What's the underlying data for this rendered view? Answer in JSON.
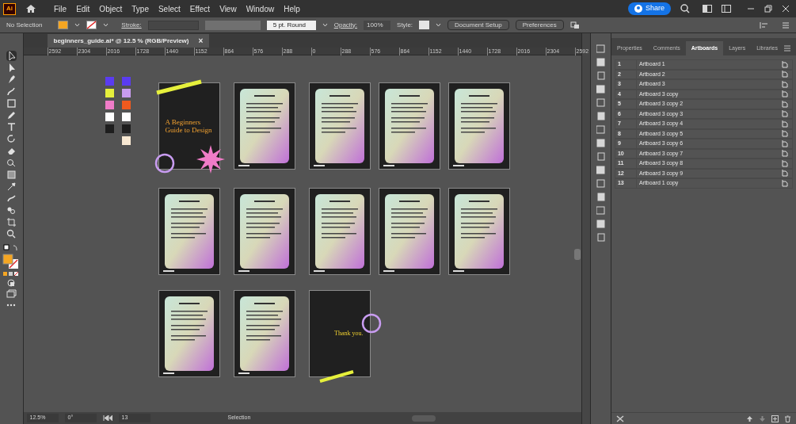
{
  "app": {
    "logo": "Ai",
    "menu": [
      "File",
      "Edit",
      "Object",
      "Type",
      "Select",
      "Effect",
      "View",
      "Window",
      "Help"
    ],
    "share": "Share"
  },
  "control_bar": {
    "selection": "No Selection",
    "stroke_label": "Stroke:",
    "brush": "5 pt. Round",
    "opacity_label": "Opacity:",
    "opacity": "100%",
    "style_label": "Style:",
    "document_setup": "Document Setup",
    "preferences": "Preferences"
  },
  "document_tab": {
    "title": "beginners_guide.ai* @ 12.5 % (RGB/Preview)",
    "close": "×"
  },
  "ruler": [
    "2592",
    "2304",
    "2016",
    "1728",
    "1440",
    "1152",
    "864",
    "576",
    "288",
    "0",
    "288",
    "576",
    "864",
    "1152",
    "1440",
    "1728",
    "2016",
    "2304",
    "2592"
  ],
  "swatches": [
    {
      "color": "#5a3cf0"
    },
    {
      "color": "#5a3cf0"
    },
    {
      "color": "#e6f03c"
    },
    {
      "color": "#c89cf0"
    },
    {
      "color": "#f07cc8"
    },
    {
      "color": "#f05a1e"
    },
    {
      "color": "#ffffff"
    },
    {
      "color": "#ffffff"
    },
    {
      "color": "#1e1e1e"
    },
    {
      "color": "#1e1e1e"
    },
    {
      "color": "#f8e8d2"
    }
  ],
  "artboards": [
    {
      "kind": "cover",
      "title": "A Beginners Guide to Design"
    },
    {
      "kind": "page"
    },
    {
      "kind": "page"
    },
    {
      "kind": "page"
    },
    {
      "kind": "page"
    },
    {
      "kind": "page"
    },
    {
      "kind": "page"
    },
    {
      "kind": "page"
    },
    {
      "kind": "page"
    },
    {
      "kind": "page"
    },
    {
      "kind": "page"
    },
    {
      "kind": "page"
    },
    {
      "kind": "thanks",
      "title": "Thank you."
    }
  ],
  "panel": {
    "tabs": [
      {
        "label": "Properties",
        "selected": false
      },
      {
        "label": "Comments",
        "selected": false
      },
      {
        "label": "Artboards",
        "selected": true
      },
      {
        "label": "Layers",
        "selected": false
      },
      {
        "label": "Libraries",
        "selected": false
      }
    ],
    "rows": [
      {
        "number": "1",
        "name": "Artboard 1"
      },
      {
        "number": "2",
        "name": "Artboard 2"
      },
      {
        "number": "3",
        "name": "Artboard 3"
      },
      {
        "number": "4",
        "name": "Artboard 3 copy"
      },
      {
        "number": "5",
        "name": "Artboard 3 copy 2"
      },
      {
        "number": "6",
        "name": "Artboard 3 copy 3"
      },
      {
        "number": "7",
        "name": "Artboard 3 copy 4"
      },
      {
        "number": "8",
        "name": "Artboard 3 copy 5"
      },
      {
        "number": "9",
        "name": "Artboard 3 copy 6"
      },
      {
        "number": "10",
        "name": "Artboard 3 copy 7"
      },
      {
        "number": "11",
        "name": "Artboard 3 copy 8"
      },
      {
        "number": "12",
        "name": "Artboard 3 copy 9"
      },
      {
        "number": "13",
        "name": "Artboard 1 copy"
      }
    ]
  },
  "status_bar": {
    "zoom": "12.5%",
    "rotation": "0°",
    "artboard": "13",
    "tool": "Selection"
  }
}
